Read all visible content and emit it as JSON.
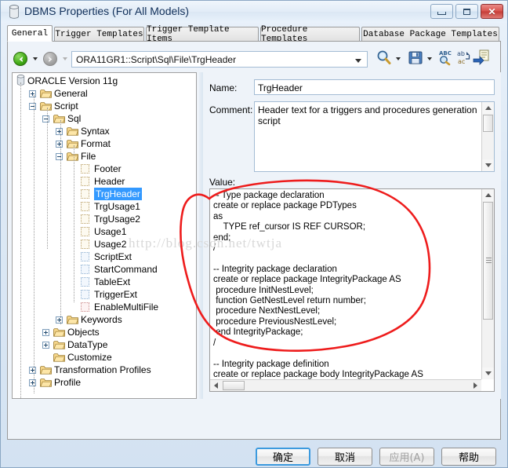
{
  "window": {
    "title": "DBMS Properties (For All Models)",
    "icon": "database-icon",
    "minimize_label": "Minimize",
    "maximize_label": "Maximize",
    "close_label": "Close"
  },
  "tabs": [
    {
      "label": "General",
      "active": true
    },
    {
      "label": "Trigger Templates",
      "active": false
    },
    {
      "label": "Trigger Template Items",
      "active": false
    },
    {
      "label": "Procedure Templates",
      "active": false
    },
    {
      "label": "Database Package Templates",
      "active": false
    }
  ],
  "toolbar": {
    "back_label": "Back",
    "forward_label": "Forward",
    "address_value": "ORA11GR1::Script\\Sql\\File\\TrgHeader",
    "find_label": "Find",
    "save_label": "Save",
    "spellcheck_label": "Spell Check",
    "replace_label": "Replace",
    "insert_label": "Insert"
  },
  "tree": {
    "root_label": "ORACLE Version 11g",
    "items": [
      {
        "label": "ORACLE Version 11g",
        "depth": 0,
        "icon": "database-icon",
        "state": "none",
        "selected": false
      },
      {
        "label": "General",
        "depth": 1,
        "icon": "folder-icon",
        "state": "plus",
        "selected": false
      },
      {
        "label": "Script",
        "depth": 1,
        "icon": "folder-icon",
        "state": "minus",
        "selected": false
      },
      {
        "label": "Sql",
        "depth": 2,
        "icon": "folder-icon",
        "state": "minus",
        "selected": false
      },
      {
        "label": "Syntax",
        "depth": 3,
        "icon": "folder-icon",
        "state": "plus",
        "selected": false
      },
      {
        "label": "Format",
        "depth": 3,
        "icon": "folder-icon",
        "state": "plus",
        "selected": false
      },
      {
        "label": "File",
        "depth": 3,
        "icon": "folder-icon",
        "state": "minus",
        "selected": false
      },
      {
        "label": "Footer",
        "depth": 4,
        "icon": "document-icon",
        "state": "none",
        "selected": false
      },
      {
        "label": "Header",
        "depth": 4,
        "icon": "document-icon",
        "state": "none",
        "selected": false
      },
      {
        "label": "TrgHeader",
        "depth": 4,
        "icon": "document-icon",
        "state": "none",
        "selected": true
      },
      {
        "label": "TrgUsage1",
        "depth": 4,
        "icon": "document-icon",
        "state": "none",
        "selected": false
      },
      {
        "label": "TrgUsage2",
        "depth": 4,
        "icon": "document-icon",
        "state": "none",
        "selected": false
      },
      {
        "label": "Usage1",
        "depth": 4,
        "icon": "document-icon",
        "state": "none",
        "selected": false
      },
      {
        "label": "Usage2",
        "depth": 4,
        "icon": "document-icon",
        "state": "none",
        "selected": false
      },
      {
        "label": "ScriptExt",
        "depth": 4,
        "icon": "value-icon",
        "state": "none",
        "selected": false
      },
      {
        "label": "StartCommand",
        "depth": 4,
        "icon": "value-icon",
        "state": "none",
        "selected": false
      },
      {
        "label": "TableExt",
        "depth": 4,
        "icon": "value-icon",
        "state": "none",
        "selected": false
      },
      {
        "label": "TriggerExt",
        "depth": 4,
        "icon": "value-icon",
        "state": "none",
        "selected": false
      },
      {
        "label": "EnableMultiFile",
        "depth": 4,
        "icon": "bool-icon",
        "state": "none",
        "selected": false
      },
      {
        "label": "Keywords",
        "depth": 3,
        "icon": "folder-icon",
        "state": "plus",
        "selected": false
      },
      {
        "label": "Objects",
        "depth": 2,
        "icon": "folder-icon",
        "state": "plus",
        "selected": false
      },
      {
        "label": "DataType",
        "depth": 2,
        "icon": "folder-icon",
        "state": "plus",
        "selected": false
      },
      {
        "label": "Customize",
        "depth": 2,
        "icon": "folder-icon",
        "state": "none",
        "selected": false
      },
      {
        "label": "Transformation Profiles",
        "depth": 1,
        "icon": "folder-icon",
        "state": "plus",
        "selected": false
      },
      {
        "label": "Profile",
        "depth": 1,
        "icon": "folder-icon",
        "state": "plus",
        "selected": false
      }
    ]
  },
  "form": {
    "name_label": "Name:",
    "name_value": "TrgHeader",
    "comment_label": "Comment:",
    "comment_value": "Header text for a triggers and procedures generation script",
    "value_label": "Value:",
    "value_text": "-- Type package declaration\ncreate or replace package PDTypes\nas\n    TYPE ref_cursor IS REF CURSOR;\nend;\n/\n\n-- Integrity package declaration\ncreate or replace package IntegrityPackage AS\n procedure InitNestLevel;\n function GetNestLevel return number;\n procedure NextNestLevel;\n procedure PreviousNestLevel;\n end IntegrityPackage;\n/\n\n-- Integrity package definition\ncreate or replace package body IntegrityPackage AS\n NestLevel number;\n\n-- Procedure to initialize the trigger nest level\n procedure InitNestLevel is\n begin"
  },
  "watermark": "http://blog.csdn.net/twtja",
  "buttons": [
    {
      "label": "确定",
      "default": true,
      "disabled": false,
      "name": "ok-button"
    },
    {
      "label": "取消",
      "default": false,
      "disabled": false,
      "name": "cancel-button"
    },
    {
      "label": "应用(A)",
      "default": false,
      "disabled": true,
      "name": "apply-button"
    },
    {
      "label": "帮助",
      "default": false,
      "disabled": false,
      "name": "help-button"
    }
  ],
  "colors": {
    "selection": "#3399ff",
    "titlebar": "#e2ecf7",
    "close_button": "#c33a34",
    "annotation": "#ee1c1c"
  }
}
